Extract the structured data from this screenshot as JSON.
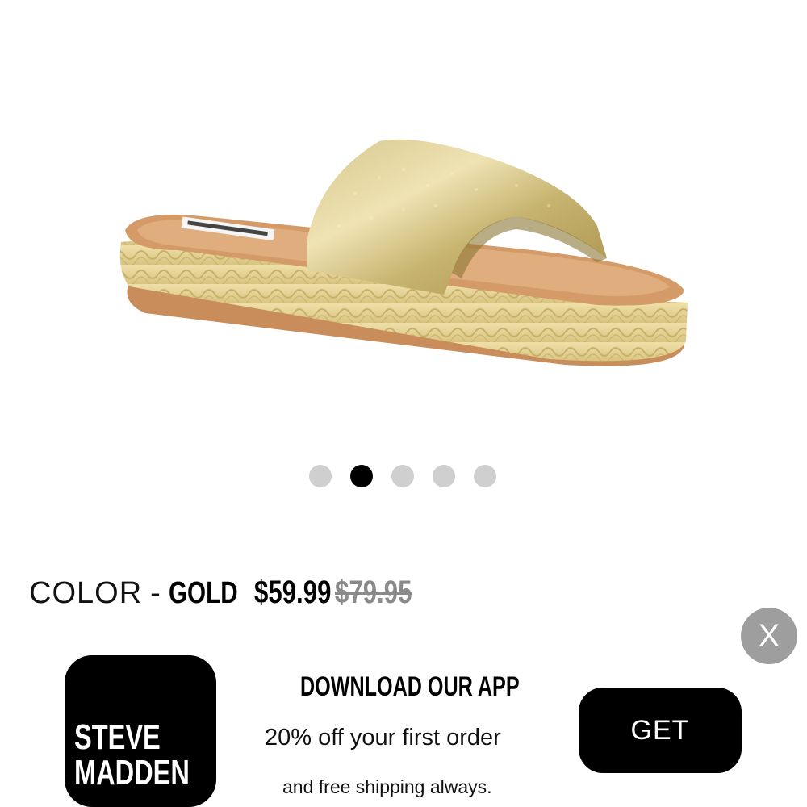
{
  "carousel": {
    "slide_count": 5,
    "active_index": 1
  },
  "product": {
    "color_label": "COLOR",
    "color_separator": "-",
    "color_value": "GOLD",
    "price": "$59.99",
    "original_price": "$79.95"
  },
  "app_banner": {
    "close_label": "X",
    "app_icon_text": "STEVE\nMADDEN",
    "title": "DOWNLOAD OUR APP",
    "line1": "20% off your first order",
    "line2": "and free shipping always.",
    "get_label": "GET"
  },
  "colors": {
    "active_dot": "#000000",
    "inactive_dot": "#cfcfcf",
    "close_button": "#9e9e9e",
    "strike_price": "#8a8a8a"
  },
  "icons": {
    "close": "close-icon",
    "product": "sandal-image"
  }
}
